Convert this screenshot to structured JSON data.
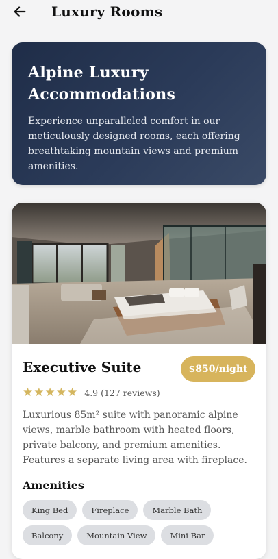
{
  "header": {
    "back_icon": "arrow-left-icon",
    "title": "Luxury Rooms"
  },
  "hero": {
    "title": "Alpine Luxury Accommodations",
    "description": "Experience unparalleled comfort in our meticulously designed rooms, each offering breathtaking mountain views and premium amenities."
  },
  "room": {
    "name": "Executive Suite",
    "price": "$850/night",
    "rating_stars": 5,
    "rating_text": "4.9 (127 reviews)",
    "description": "Luxurious 85m² suite with panoramic alpine views, marble bathroom with heated floors, private balcony, and premium amenities. Features a separate living area with fireplace.",
    "amenities_title": "Amenities",
    "amenities": [
      "King Bed",
      "Fireplace",
      "Marble Bath",
      "Balcony",
      "Mountain View",
      "Mini Bar"
    ]
  },
  "colors": {
    "hero_bg": "#24334f",
    "price_badge": "#d7b45c",
    "star": "#d4b65f",
    "chip_bg": "#dcdee2"
  }
}
